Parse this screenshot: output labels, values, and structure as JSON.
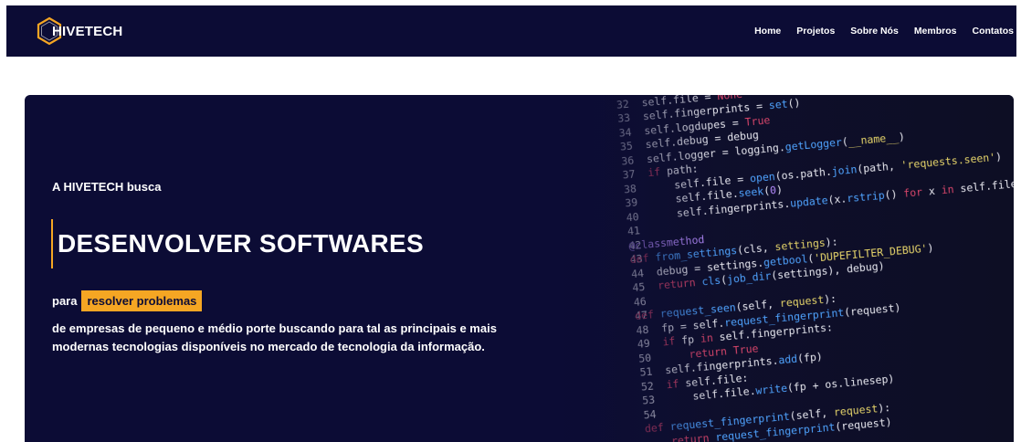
{
  "brand": {
    "name": "HIVETECH",
    "accent_color": "#f5a623",
    "navy_color": "#0c0c35"
  },
  "nav": {
    "items": [
      {
        "label": "Home"
      },
      {
        "label": "Projetos"
      },
      {
        "label": "Sobre Nós"
      },
      {
        "label": "Membros"
      },
      {
        "label": "Contatos"
      }
    ]
  },
  "hero": {
    "intro": "A HIVETECH busca",
    "headline": "DESENVOLVER SOFTWARES",
    "prefix": "para",
    "highlight": "resolver problemas",
    "description": "de empresas de pequeno e médio porte buscando para tal as principais e mais modernas tecnologias disponíveis no mercado de tecnologia da informação.",
    "background_image": "code-editor-screenshot"
  }
}
